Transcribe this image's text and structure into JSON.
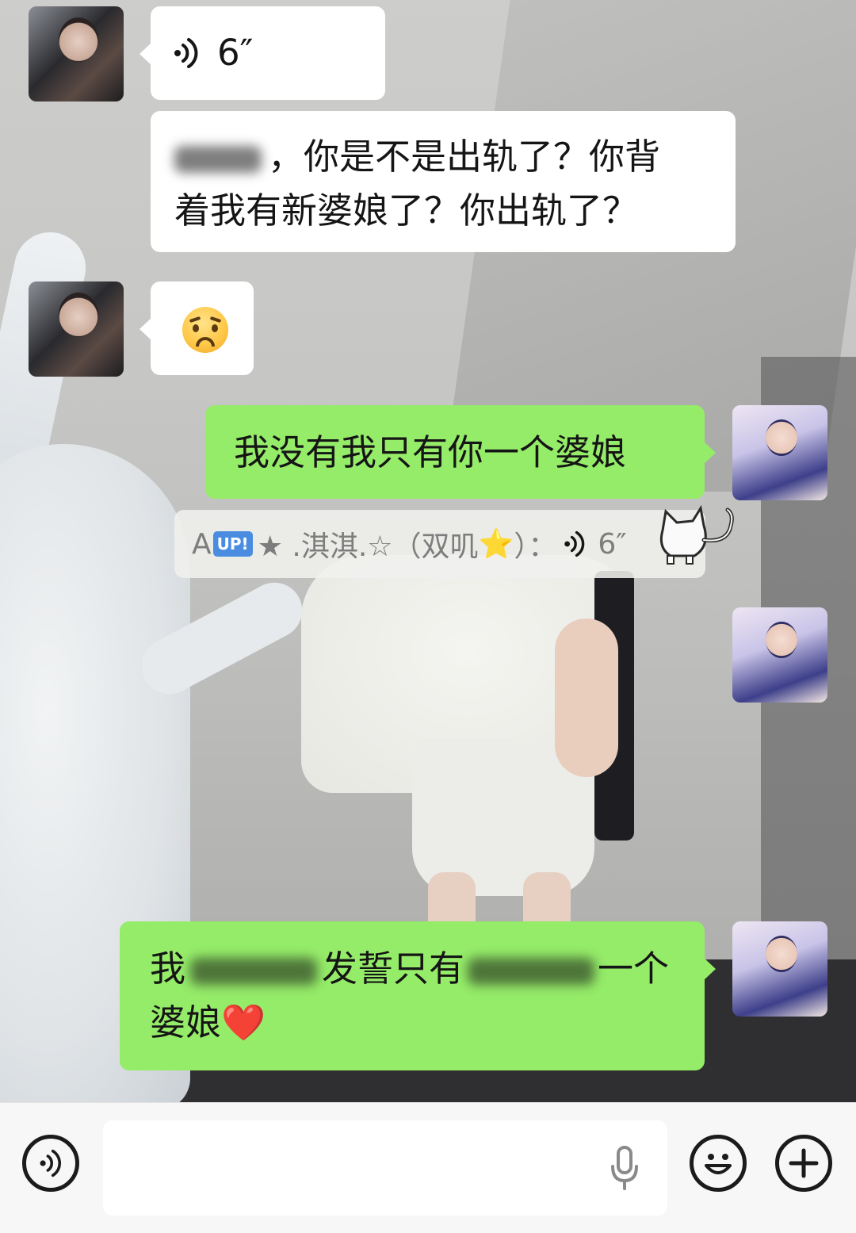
{
  "background": {
    "description_colors": [
      "#cdcdcb",
      "#2f2f31"
    ]
  },
  "colors": {
    "bubble_green": "#95ec69",
    "bubble_white": "#ffffff",
    "system_gray": "#7d7d7d"
  },
  "messages": [
    {
      "side": "other",
      "type": "voice",
      "duration": "6″",
      "icon": "voice-wave-icon"
    },
    {
      "side": "other",
      "type": "text",
      "line1": "，你是不是出轨了？你背",
      "line2": "着我有新婆娘了？你出轨了？"
    },
    {
      "side": "other",
      "type": "emoji",
      "emoji": "pleading-face-emoji"
    },
    {
      "side": "me",
      "type": "text",
      "text": "我没有我只有你一个婆娘"
    },
    {
      "side": "me",
      "type": "voice-forward",
      "badge": "UP!",
      "sender_prefix": "A",
      "sender_name": "★ .淇淇.☆（双叽",
      "star": "⭐",
      "sender_suffix": "）：",
      "duration": "6″"
    },
    {
      "side": "me",
      "type": "text",
      "part1": "我",
      "part2": "发誓只有",
      "part3": "一个",
      "line2": "婆娘",
      "heart": "❤️"
    }
  ],
  "input_bar": {
    "voice_button_icon": "voice-mode-icon",
    "mic_icon": "microphone-icon",
    "emoji_button_icon": "smiley-icon",
    "plus_button_icon": "plus-icon",
    "placeholder": ""
  }
}
